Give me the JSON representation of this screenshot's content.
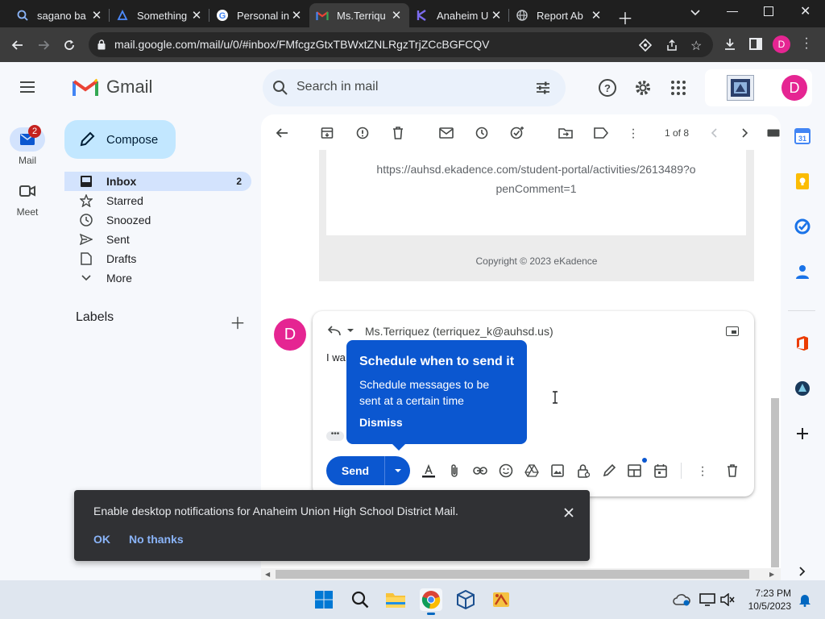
{
  "browser": {
    "tabs": [
      {
        "label": "sagano ba",
        "icon": "search-icon"
      },
      {
        "label": "Something",
        "icon": "azure-icon"
      },
      {
        "label": "Personal in",
        "icon": "google-icon"
      },
      {
        "label": "Ms.Terriqu",
        "icon": "gmail-icon",
        "active": true
      },
      {
        "label": "Anaheim U",
        "icon": "kadence-icon"
      },
      {
        "label": "Report Ab",
        "icon": "globe-icon"
      }
    ],
    "url": "mail.google.com/mail/u/0/#inbox/FMfcgzGtxTBWxtZNLRgzTrjZCcBGFCQV",
    "profile_initial": "D"
  },
  "gmail": {
    "logo_text": "Gmail",
    "search_placeholder": "Search in mail",
    "account_initial": "D",
    "rail": {
      "mail_label": "Mail",
      "mail_badge": "2",
      "meet_label": "Meet"
    },
    "compose_label": "Compose",
    "nav": [
      {
        "label": "Inbox",
        "count": "2",
        "icon": "inbox-icon",
        "active": true
      },
      {
        "label": "Starred",
        "count": "",
        "icon": "star-icon"
      },
      {
        "label": "Snoozed",
        "count": "",
        "icon": "clock-icon"
      },
      {
        "label": "Sent",
        "count": "",
        "icon": "send-icon"
      },
      {
        "label": "Drafts",
        "count": "",
        "icon": "draft-icon"
      },
      {
        "label": "More",
        "count": "",
        "icon": "chevron-down-icon"
      }
    ],
    "labels_title": "Labels",
    "toolbar": {
      "pager": "1 of 8"
    },
    "message": {
      "link_line1": "https://auhsd.ekadence.com/student-portal/activities/2613489?o",
      "link_line2": "penComment=1",
      "copyright": "Copyright © 2023 eKadence"
    },
    "reply": {
      "avatar_initial": "D",
      "to": "Ms.Terriquez (terriquez_k@auhsd.us)",
      "body_partial": "I wa",
      "ellipsis": "•••",
      "send_label": "Send"
    },
    "tooltip": {
      "title": "Schedule when to send it",
      "description": "Schedule messages to be sent at a certain time",
      "dismiss_label": "Dismiss"
    },
    "snackbar": {
      "message": "Enable desktop notifications for Anaheim Union High School District Mail.",
      "ok_label": "OK",
      "no_label": "No thanks"
    }
  },
  "taskbar": {
    "time": "7:23 PM",
    "date": "10/5/2023"
  },
  "colors": {
    "accent": "#0b57d0",
    "compose_bg": "#c2e7ff",
    "active_nav_bg": "#d3e3fd",
    "avatar": "#e52592",
    "badge": "#c5221f"
  }
}
